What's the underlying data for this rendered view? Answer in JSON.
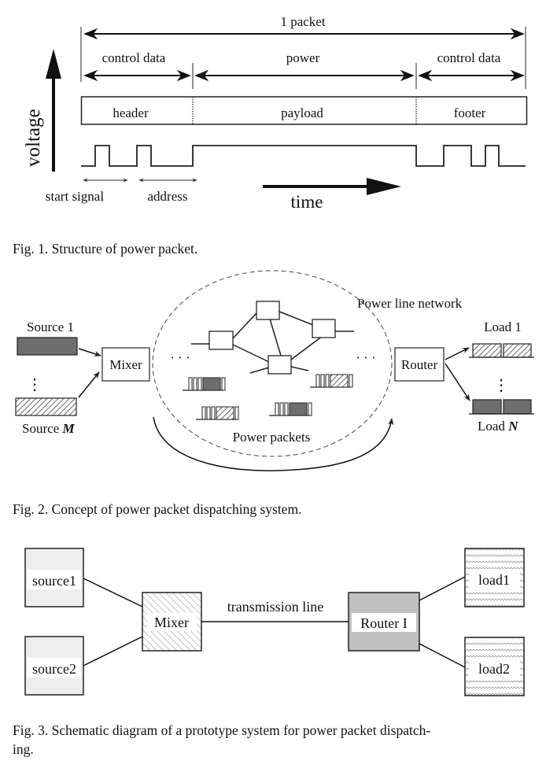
{
  "fig1": {
    "y_axis_label": "voltage",
    "x_axis_label": "time",
    "span_total": "1 packet",
    "span_header": "control data",
    "span_payload": "power",
    "span_footer": "control data",
    "segment_header": "header",
    "segment_payload": "payload",
    "segment_footer": "footer",
    "marker_start": "start signal",
    "marker_address": "address",
    "caption": "Fig. 1.  Structure of power packet."
  },
  "fig2": {
    "network_label": "Power line network",
    "packets_label": "Power packets",
    "source_first": "Source 1",
    "source_last_prefix": "Source ",
    "source_last_var": "M",
    "mixer": "Mixer",
    "router": "Router",
    "load_first": "Load 1",
    "load_last_prefix": "Load ",
    "load_last_var": "N",
    "ellipsis": "· · ·",
    "vdots": "⋮",
    "caption": "Fig. 2.  Concept of power packet dispatching system.",
    "colors": {
      "solid_fill": "#6e6e6e",
      "hatch": "#444444"
    }
  },
  "fig3": {
    "source1": "source1",
    "source2": "source2",
    "mixer": "Mixer",
    "line_label": "transmission line",
    "router": "Router I",
    "load1": "load1",
    "load2": "load2",
    "caption_line1": "Fig. 3.  Schematic diagram of a prototype system for power packet dispatch-",
    "caption_line2": "ing.",
    "colors": {
      "source_fill": "#eeeeee",
      "router_fill": "#c0c0c0"
    }
  }
}
